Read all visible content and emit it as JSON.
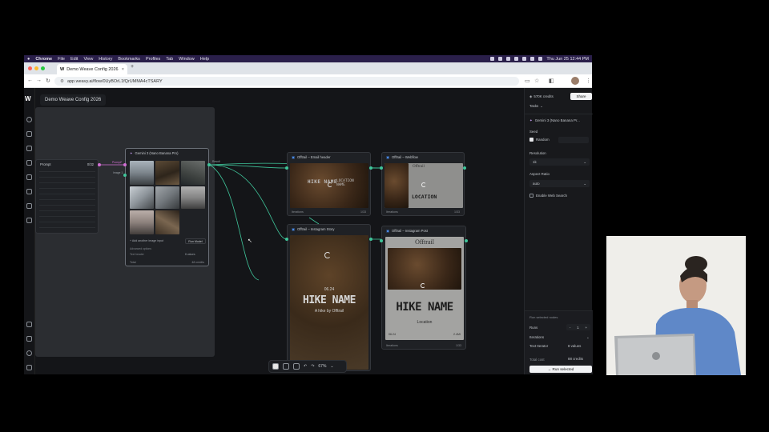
{
  "menubar": {
    "app": "Chrome",
    "items": [
      "File",
      "Edit",
      "View",
      "History",
      "Bookmarks",
      "Profiles",
      "Tab",
      "Window",
      "Help"
    ],
    "clock": "Thu Jun 25  12:44 PM"
  },
  "browser": {
    "tab_title": "Demo Weave Config 2026",
    "url": "app.weavy.ai/flow/0UyBOrL1fQrUMMA4cTSARY"
  },
  "app": {
    "project_title": "Demo Weave Config 2026",
    "credits": "570K credits",
    "share_label": "Share",
    "tasks_label": "Tasks"
  },
  "nodes": {
    "gemini": {
      "title": "Gemini 3 (Nano Banana Pro)",
      "port_prompt": "Prompt*",
      "port_image": "Image 1",
      "port_result": "Result",
      "add_image_label": "+ Add another image input",
      "run_label": "Run Model",
      "advanced_label": "Advanced options",
      "text_header_label": "Text header",
      "text_header_value": "8 values",
      "foot_left": "Total",
      "foot_right": "48 credits"
    },
    "prompt_node": {
      "title": "Prompt",
      "meta": "0/32"
    },
    "email": {
      "title": "Offtrail – Email header",
      "headline": "HIKE NAME",
      "sub": "LOCATION NAME",
      "foot_left": "Iterations",
      "foot_right": "1/33"
    },
    "web": {
      "title": "Offtrail – Webflow",
      "brand": "Offtrail",
      "headline": "LOCATION",
      "foot_left": "Iterations",
      "foot_right": "1/33"
    },
    "story": {
      "title": "Offtrail – Instagram Story",
      "date": "06.24",
      "headline": "HIKE NAME",
      "sub": "A hike by Offtrail"
    },
    "post": {
      "title": "Offtrail – Instagram Post",
      "brand": "Offtrail",
      "headline": "HIKE NAME",
      "sub": "Location",
      "date": "06.24",
      "right": "2.4MI",
      "foot_left": "Iterations",
      "foot_right": "1/33"
    }
  },
  "panel": {
    "model": "Gemini 3 (Nano Banana Pr...",
    "seed_label": "Seed",
    "random_label": "Random",
    "resolution_label": "Resolution",
    "resolution_value": "1k",
    "aspect_label": "Aspect Ratio",
    "aspect_value": "auto",
    "websearch_label": "Enable Web Search",
    "run_selected_header": "Run selected nodes",
    "runs_label": "Runs",
    "runs_value": "1",
    "iterations_label": "Iterations",
    "text_iterator_label": "Text Iterator",
    "text_iterator_value": "8 values",
    "total_label": "Total cost",
    "total_value": "88 credits",
    "run_button": "→ Run selected"
  },
  "toolbar": {
    "zoom": "67%"
  }
}
